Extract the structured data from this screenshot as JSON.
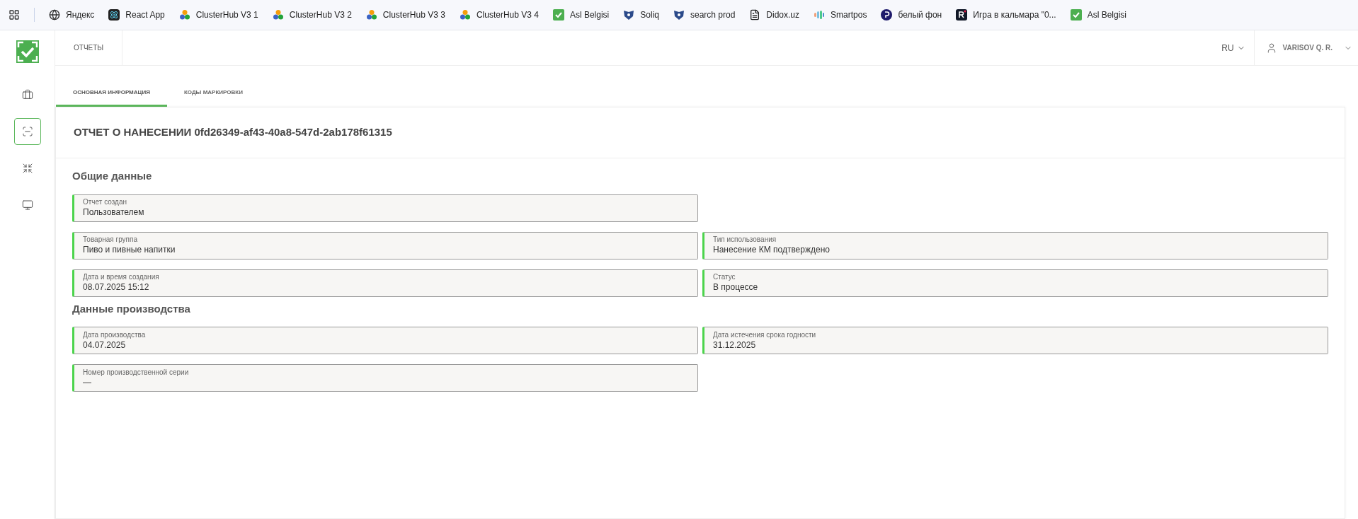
{
  "bookmarks": [
    {
      "kind": "globe",
      "label": "Яндекс"
    },
    {
      "kind": "atom",
      "label": "React App"
    },
    {
      "kind": "hexes",
      "label": "ClusterHub V3 1"
    },
    {
      "kind": "hexes",
      "label": "ClusterHub V3 2"
    },
    {
      "kind": "hexes",
      "label": "ClusterHub V3 3"
    },
    {
      "kind": "hexes",
      "label": "ClusterHub V3 4"
    },
    {
      "kind": "check",
      "label": "Asl Belgisi"
    },
    {
      "kind": "shield",
      "label": "Soliq"
    },
    {
      "kind": "shield",
      "label": "search prod"
    },
    {
      "kind": "doc",
      "label": "Didox.uz"
    },
    {
      "kind": "waves",
      "label": "Smartpos"
    },
    {
      "kind": "disc",
      "label": "белый фон"
    },
    {
      "kind": "square",
      "label": "Игра в кальмара \"0..."
    },
    {
      "kind": "check",
      "label": "Asl Belgisi"
    }
  ],
  "sidebar": {
    "items": [
      {
        "kind": "briefcase",
        "selected": false
      },
      {
        "kind": "scan",
        "selected": true
      },
      {
        "kind": "shrink",
        "selected": false
      },
      {
        "kind": "monitor",
        "selected": false
      }
    ]
  },
  "header": {
    "section": "ОТЧЕТЫ",
    "language": "RU",
    "user": "VARISOV Q. R."
  },
  "tabs": [
    {
      "label": "ОСНОВНАЯ ИНФОРМАЦИЯ",
      "selected": true
    },
    {
      "label": "КОДЫ МАРКИРОВКИ",
      "selected": false
    }
  ],
  "title": "ОТЧЕТ О НАНЕСЕНИИ 0fd26349-af43-40a8-547d-2ab178f61315",
  "sections": [
    {
      "heading": "Общие данные",
      "rows": [
        [
          {
            "label": "Отчет создан",
            "value": "Пользователем"
          }
        ],
        [
          {
            "label": "Товарная группа",
            "value": "Пиво и пивные напитки"
          },
          {
            "label": "Тип использования",
            "value": "Нанесение КМ подтверждено"
          }
        ],
        [
          {
            "label": "Дата и время создания",
            "value": "08.07.2025 15:12"
          },
          {
            "label": "Статус",
            "value": "В процессе"
          }
        ]
      ]
    },
    {
      "heading": "Данные производства",
      "rows": [
        [
          {
            "label": "Дата производства",
            "value": "04.07.2025"
          },
          {
            "label": "Дата истечения срока годности",
            "value": "31.12.2025"
          }
        ],
        [
          {
            "label": "Номер производственной серии",
            "value": "—"
          }
        ]
      ]
    }
  ]
}
